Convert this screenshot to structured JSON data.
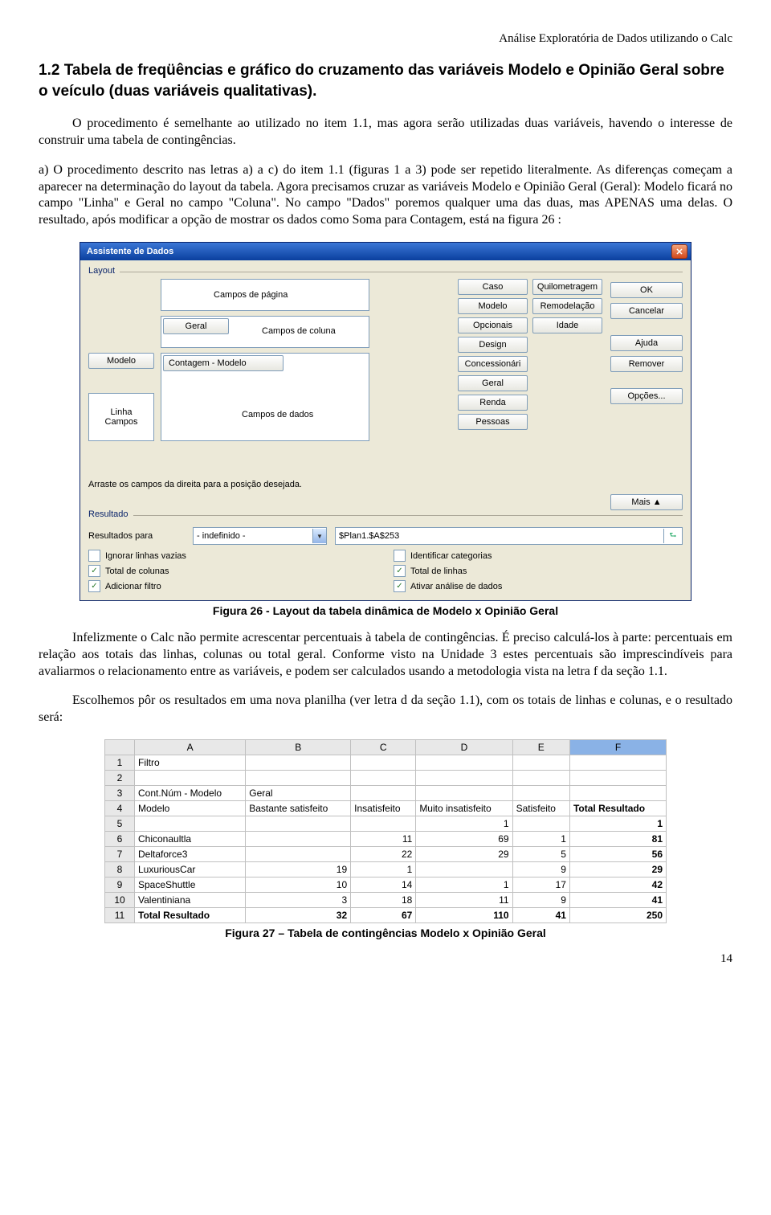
{
  "header": {
    "right": "Análise Exploratória de Dados utilizando o Calc"
  },
  "page_number": "14",
  "section_title": "1.2 Tabela de freqüências e gráfico do cruzamento das variáveis Modelo e Opinião Geral sobre o veículo (duas variáveis qualitativas).",
  "para_a": "O procedimento é semelhante ao utilizado no item 1.1, mas agora serão utilizadas duas variáveis, havendo o interesse de construir uma tabela de contingências.",
  "para_b": "a) O procedimento descrito nas letras a) a c) do item 1.1 (figuras 1 a 3) pode ser repetido literalmente. As diferenças começam a aparecer na determinação do layout da tabela. Agora precisamos cruzar as variáveis Modelo e Opinião Geral (Geral): Modelo ficará no campo \"Linha\" e Geral no campo \"Coluna\". No campo \"Dados\" poremos qualquer uma das duas, mas APENAS uma delas. O resultado, após modificar a opção de mostrar os dados como Soma para Contagem, está na figura 26 :",
  "fig26_caption": "Figura 26 - Layout da tabela dinâmica de Modelo x Opinião Geral",
  "para_c": "Infelizmente o Calc não permite acrescentar percentuais à tabela de contingências. É preciso calculá-los à parte: percentuais em relação aos totais das linhas, colunas ou total geral. Conforme visto na Unidade 3 estes percentuais são imprescindíveis para avaliarmos o relacionamento entre as variáveis, e podem ser calculados usando a metodologia vista na letra f da seção 1.1.",
  "para_d": "Escolhemos pôr os resultados em uma nova planilha (ver letra d da seção 1.1), com os totais de linhas e colunas, e o resultado será:",
  "fig27_caption": "Figura 27 – Tabela de contingências Modelo x Opinião Geral",
  "dialog": {
    "title": "Assistente de Dados",
    "groups": {
      "layout": "Layout",
      "resultado": "Resultado"
    },
    "zones": {
      "page": "Campos de página",
      "col": "Campos de coluna",
      "row": "Linha\nCampos",
      "data": "Campos de dados"
    },
    "row_btn": "Modelo",
    "col_btn": "Geral",
    "data_btn": "Contagem - Modelo",
    "avail_col_a": [
      "Caso",
      "Modelo",
      "Opcionais",
      "Design",
      "Concessionári",
      "Geral",
      "Renda",
      "Pessoas"
    ],
    "avail_col_b": [
      "Quilometragem",
      "Remodelação",
      "Idade"
    ],
    "hint": "Arraste os campos da direita para a posição desejada.",
    "right_buttons": {
      "ok": "OK",
      "cancelar": "Cancelar",
      "ajuda": "Ajuda",
      "remover": "Remover",
      "opcoes": "Opções...",
      "mais": "Mais"
    },
    "result": {
      "label": "Resultados para",
      "seletor_value": "- indefinido -",
      "ref_value": "$Plan1.$A$253"
    },
    "checks": {
      "ignorar": {
        "label": "Ignorar linhas vazias",
        "checked": false
      },
      "identificar": {
        "label": "Identificar categorias",
        "checked": false
      },
      "total_col": {
        "label": "Total de colunas",
        "checked": true
      },
      "total_lin": {
        "label": "Total de linhas",
        "checked": true
      },
      "filtro": {
        "label": "Adicionar filtro",
        "checked": true
      },
      "ativar": {
        "label": "Ativar análise de dados",
        "checked": true
      }
    }
  },
  "sheet": {
    "cols": [
      "A",
      "B",
      "C",
      "D",
      "E",
      "F"
    ],
    "rows": [
      {
        "n": "1",
        "cells": [
          "Filtro",
          "",
          "",
          "",
          "",
          ""
        ],
        "bold_cols": []
      },
      {
        "n": "2",
        "cells": [
          "",
          "",
          "",
          "",
          "",
          ""
        ],
        "bold_cols": []
      },
      {
        "n": "3",
        "cells": [
          "Cont.Núm - Modelo",
          "Geral",
          "",
          "",
          "",
          ""
        ],
        "bold_cols": []
      },
      {
        "n": "4",
        "cells": [
          "Modelo",
          "Bastante satisfeito",
          "Insatisfeito",
          "Muito insatisfeito",
          "Satisfeito",
          "Total Resultado"
        ],
        "bold_cols": [
          5
        ]
      },
      {
        "n": "5",
        "cells": [
          "",
          "",
          "",
          "1",
          "",
          "1"
        ],
        "bold_cols": [
          5
        ]
      },
      {
        "n": "6",
        "cells": [
          "Chiconaultla",
          "",
          "11",
          "69",
          "1",
          "81"
        ],
        "bold_cols": [
          5
        ]
      },
      {
        "n": "7",
        "cells": [
          "Deltaforce3",
          "",
          "22",
          "29",
          "5",
          "56"
        ],
        "bold_cols": [
          5
        ]
      },
      {
        "n": "8",
        "cells": [
          "LuxuriousCar",
          "19",
          "1",
          "",
          "9",
          "29"
        ],
        "bold_cols": [
          5
        ]
      },
      {
        "n": "9",
        "cells": [
          "SpaceShuttle",
          "10",
          "14",
          "1",
          "17",
          "42"
        ],
        "bold_cols": [
          5
        ]
      },
      {
        "n": "10",
        "cells": [
          "Valentiniana",
          "3",
          "18",
          "11",
          "9",
          "41"
        ],
        "bold_cols": [
          5
        ]
      },
      {
        "n": "11",
        "cells": [
          "Total Resultado",
          "32",
          "67",
          "110",
          "41",
          "250"
        ],
        "bold_cols": [
          0,
          1,
          2,
          3,
          4,
          5
        ]
      }
    ]
  }
}
